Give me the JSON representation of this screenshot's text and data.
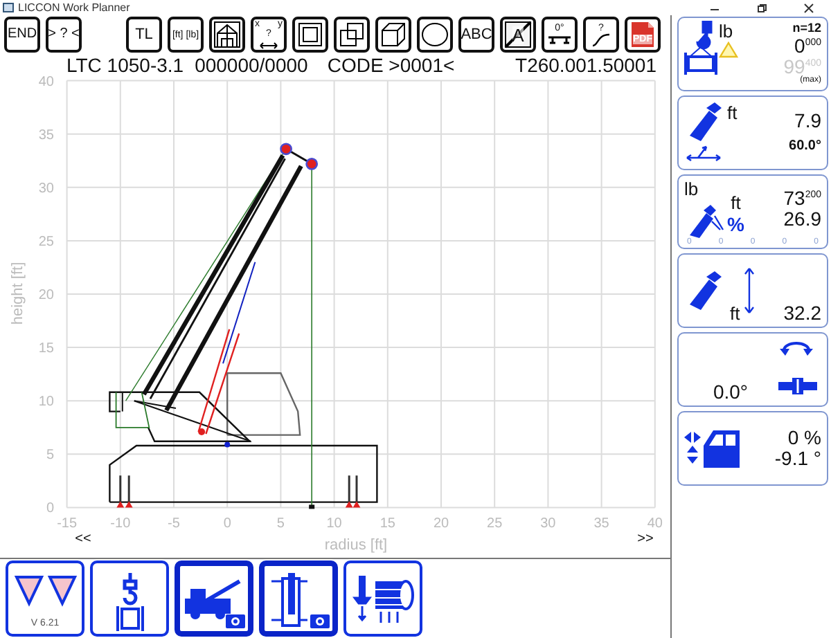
{
  "window": {
    "title": "LICCON Work Planner"
  },
  "toolbar": {
    "left": [
      {
        "kind": "text",
        "label": "END"
      },
      {
        "kind": "text",
        "label": "> ? <"
      }
    ],
    "main": [
      {
        "kind": "text",
        "label": "TL"
      },
      {
        "kind": "text",
        "label": "[ft] [lb]"
      },
      {
        "kind": "icon"
      },
      {
        "kind": "icon",
        "marks": [
          "x",
          "y",
          "?"
        ]
      },
      {
        "kind": "icon"
      },
      {
        "kind": "icon"
      },
      {
        "kind": "icon"
      },
      {
        "kind": "icon"
      },
      {
        "kind": "text",
        "label": "ABC"
      },
      {
        "kind": "overlay",
        "marks": [
          "A"
        ]
      },
      {
        "kind": "icon",
        "marks": [
          "0°"
        ]
      },
      {
        "kind": "icon",
        "marks": [
          "?"
        ]
      },
      {
        "kind": "overlay",
        "marks": [
          "PDF"
        ]
      }
    ]
  },
  "header": {
    "model": "LTC 1050-3.1",
    "number": "000000/0000",
    "code": "CODE >0001<",
    "table": "T260.001.50001"
  },
  "plot": {
    "xlabel": "radius [ft]",
    "ylabel": "height [ft]",
    "xticks": [
      "-15",
      "-10",
      "-5",
      "0",
      "5",
      "10",
      "15",
      "20",
      "25",
      "30",
      "35",
      "40"
    ],
    "yticks": [
      "40",
      "35",
      "30",
      "25",
      "20",
      "15",
      "10",
      "5",
      "0"
    ],
    "prev": "<<",
    "next": ">>"
  },
  "bottom_buttons": [
    {
      "label": "V 6.21",
      "selected": false
    },
    {
      "selected": false
    },
    {
      "selected": true
    },
    {
      "selected": true
    },
    {
      "selected": false
    }
  ],
  "panels": [
    {
      "kind": "load",
      "count": "n=12",
      "unit": "lb",
      "value": "0$^{000}$",
      "max": "99$^{400}$",
      "max_label": "(max)",
      "warning": true
    },
    {
      "kind": "radius",
      "unit": "ft",
      "value": "7.9",
      "angle": "60.0°"
    },
    {
      "kind": "length",
      "weight_unit": "lb",
      "unit": "ft",
      "percent": "%",
      "weight": "73$^{200}$",
      "value": "26.9",
      "scale": [
        "0",
        "0",
        "0",
        "0",
        "0"
      ]
    },
    {
      "kind": "height",
      "unit": "ft",
      "value": "32.2"
    },
    {
      "kind": "slew",
      "value": "0.0°"
    },
    {
      "kind": "incline",
      "value_1": "0 %",
      "value_2": "-9.1 °"
    }
  ]
}
